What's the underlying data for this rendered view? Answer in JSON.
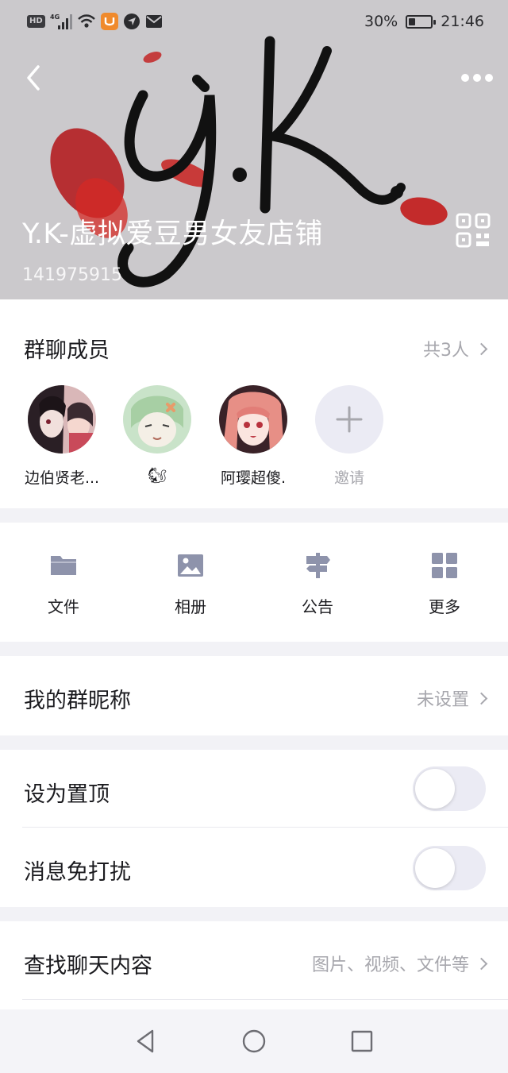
{
  "status_bar": {
    "hd": "HD",
    "network": "4G",
    "battery_percent": "30%",
    "battery_level": 0.3,
    "time": "21:46"
  },
  "header": {
    "logo_text": "y.K.",
    "group_name": "Y.K-虚拟爱豆男女友店铺",
    "group_id": "141975915"
  },
  "members_section": {
    "title": "群聊成员",
    "count_label": "共3人",
    "members": [
      {
        "name": "边伯贤老..."
      },
      {
        "name": "🐿"
      },
      {
        "name": "阿璎超傻."
      }
    ],
    "invite_label": "邀请"
  },
  "tools": [
    {
      "label": "文件",
      "icon": "folder-icon"
    },
    {
      "label": "相册",
      "icon": "image-icon"
    },
    {
      "label": "公告",
      "icon": "signpost-icon"
    },
    {
      "label": "更多",
      "icon": "grid-icon"
    }
  ],
  "nickname_row": {
    "label": "我的群昵称",
    "value": "未设置"
  },
  "pin_row": {
    "label": "设为置顶",
    "on": false
  },
  "dnd_row": {
    "label": "消息免打扰",
    "on": false
  },
  "search_row": {
    "label": "查找聊天内容",
    "hint": "图片、视频、文件等"
  },
  "colors": {
    "header_bg": "#cbc9cc",
    "accent_red": "#c21a1a",
    "toggle_off": "#ebebf4",
    "muted_text": "#a7a7ad"
  }
}
